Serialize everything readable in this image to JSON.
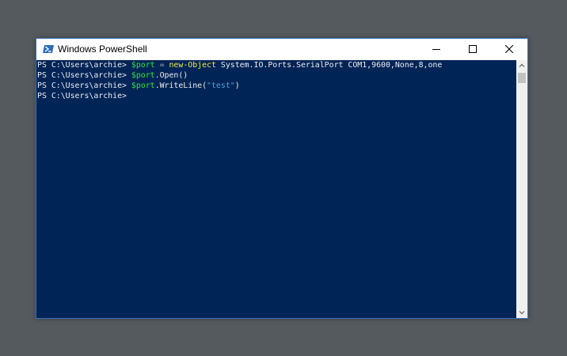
{
  "window": {
    "title": "Windows PowerShell"
  },
  "console": {
    "lines": [
      {
        "prompt": "PS C:\\Users\\archie> ",
        "var": "$port",
        "op": " = ",
        "cmd": "new-Object",
        "rest": " System.IO.Ports.SerialPort COM1,9600,None,8,one"
      },
      {
        "prompt": "PS C:\\Users\\archie> ",
        "var": "$port",
        "rest": ".Open()"
      },
      {
        "prompt": "PS C:\\Users\\archie> ",
        "var": "$port",
        "rest": ".WriteLine(",
        "str": "\"test\"",
        "close": ")"
      },
      {
        "prompt": "PS C:\\Users\\archie>"
      }
    ]
  },
  "icons": {
    "app": "powershell-icon",
    "minimize": "minimize-icon",
    "maximize": "maximize-icon",
    "close": "close-icon",
    "scroll_up": "chevron-up-icon",
    "scroll_down": "chevron-down-icon"
  },
  "colors": {
    "console_background": "#012456",
    "text": "#eeedf0",
    "variable": "#2ee63c",
    "command": "#f2e84c",
    "operator": "#9ea3a9",
    "string": "#49a2d6",
    "desktop": "#545a5e"
  }
}
